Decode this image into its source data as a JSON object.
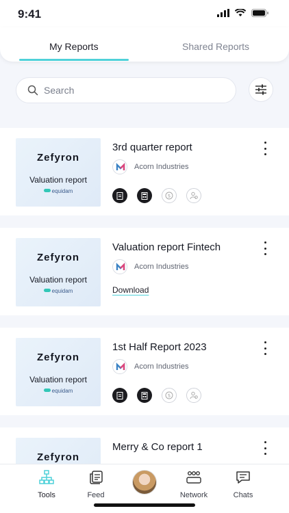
{
  "status_bar": {
    "time": "9:41"
  },
  "tabs": [
    {
      "label": "My Reports"
    },
    {
      "label": "Shared Reports"
    }
  ],
  "search": {
    "placeholder": "Search"
  },
  "cards": [
    {
      "thumb_brand": "Zefyron",
      "thumb_subtitle": "Valuation report",
      "thumb_footer": "equidam",
      "title": "3rd quarter report",
      "company": "Acorn Industries",
      "action": "icons"
    },
    {
      "thumb_brand": "Zefyron",
      "thumb_subtitle": "Valuation report",
      "thumb_footer": "equidam",
      "title": "Valuation report Fintech",
      "company": "Acorn Industries",
      "action": "Download"
    },
    {
      "thumb_brand": "Zefyron",
      "thumb_subtitle": "Valuation report",
      "thumb_footer": "equidam",
      "title": "1st Half Report 2023",
      "company": "Acorn Industries",
      "action": "icons"
    },
    {
      "thumb_brand": "Zefyron",
      "title": "Merry & Co report 1"
    }
  ],
  "nav": [
    {
      "label": "Tools",
      "icon": "org-chart-icon"
    },
    {
      "label": "Feed",
      "icon": "feed-icon"
    },
    {
      "label": "",
      "icon": "avatar"
    },
    {
      "label": "Network",
      "icon": "people-icon"
    },
    {
      "label": "Chats",
      "icon": "chat-icon"
    }
  ],
  "colors": {
    "accent": "#4fd1d9",
    "background": "#f4f6fb"
  }
}
